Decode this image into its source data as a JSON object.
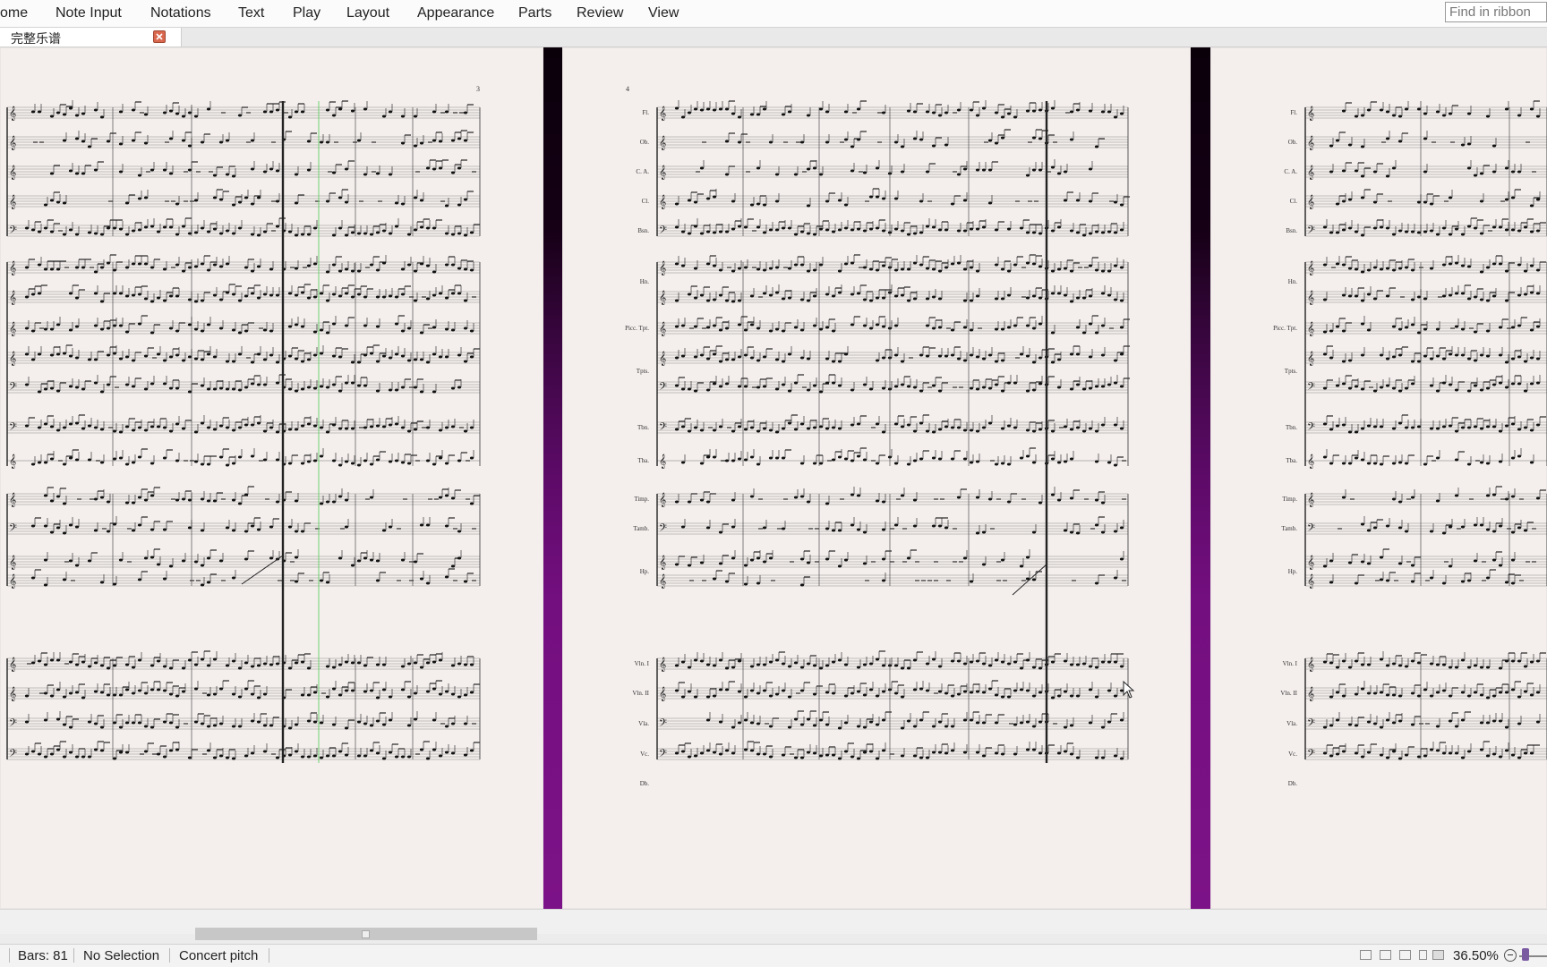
{
  "menu": {
    "items": [
      "ome",
      "Note Input",
      "Notations",
      "Text",
      "Play",
      "Layout",
      "Appearance",
      "Parts",
      "Review",
      "View"
    ],
    "search_placeholder": "Find in ribbon"
  },
  "tab": {
    "title": "完整乐谱"
  },
  "score": {
    "pages": [
      {
        "number": "3"
      },
      {
        "number": "4"
      }
    ],
    "instrument_labels": [
      "Fl.",
      "Ob.",
      "C. A.",
      "Cl.",
      "Bsn.",
      "Hn.",
      "Picc. Tpt.",
      "Tpts.",
      "Tbn.",
      "Tba.",
      "Timp.",
      "Tamb.",
      "Hp.",
      "Vln. I",
      "Vln. II",
      "Vla.",
      "Vc.",
      "Db."
    ]
  },
  "status": {
    "bars": "Bars: 81",
    "selection": "No Selection",
    "pitch": "Concert pitch",
    "zoom": "36.50%"
  },
  "colors": {
    "canvas_top": "#0a000a",
    "canvas_bottom": "#7c1287",
    "paper": "#f4efed",
    "playback_line": "#6fd06f"
  }
}
